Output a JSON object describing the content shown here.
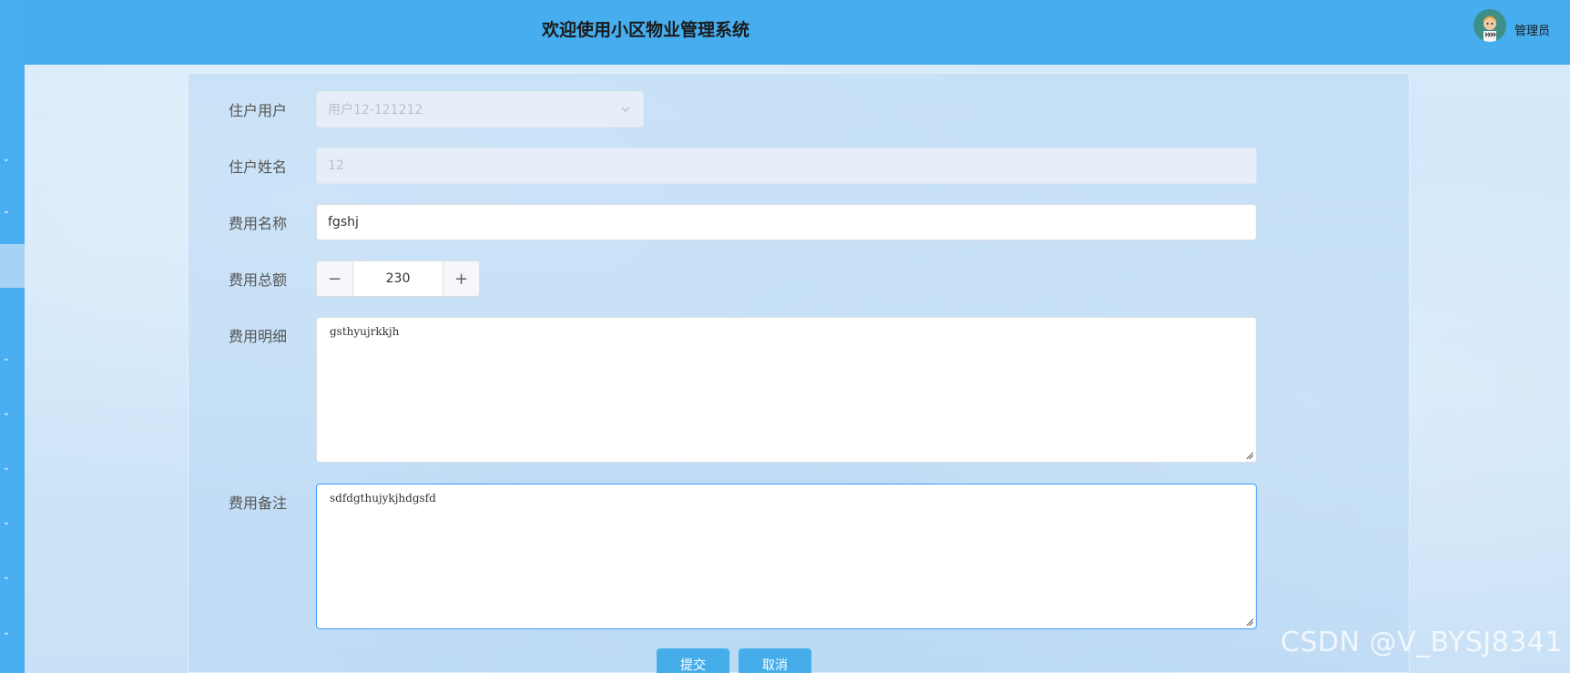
{
  "header": {
    "title": "欢迎使用小区物业管理系统",
    "user_name": "管理员"
  },
  "form": {
    "resident_user": {
      "label": "住户用户",
      "value": "用户12-121212"
    },
    "resident_name": {
      "label": "住户姓名",
      "value": "12"
    },
    "fee_name": {
      "label": "费用名称",
      "value": "fgshj"
    },
    "fee_total": {
      "label": "费用总额",
      "value": "230",
      "minus": "−",
      "plus": "+"
    },
    "fee_detail": {
      "label": "费用明细",
      "value": "gsthyujrkkjh"
    },
    "fee_remark": {
      "label": "费用备注",
      "value": "sdfdgthujykjhdgsfd"
    },
    "submit_label": "提交",
    "cancel_label": "取消"
  },
  "watermark": "CSDN @V_BYSJ8341",
  "colors": {
    "header_bg": "#46adef",
    "sidebar_bg": "#48aef0",
    "primary_button": "#45aeea",
    "focus_border": "#409eff"
  },
  "icons": {
    "sidebar": "chevron-down-icon",
    "select": "chevron-down-icon",
    "avatar": "user-avatar-icon"
  }
}
